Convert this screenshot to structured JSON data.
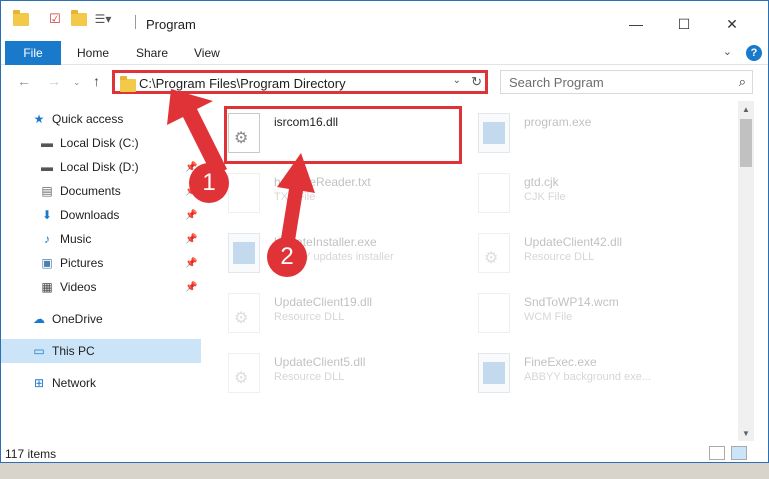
{
  "window": {
    "title": "Program",
    "controls": {
      "minimize": "—",
      "maximize": "☐",
      "close": "✕"
    }
  },
  "ribbon": {
    "tabs": [
      "File",
      "Home",
      "Share",
      "View"
    ],
    "help": "?"
  },
  "nav": {
    "address": "C:\\Program Files\\Program Directory",
    "search_placeholder": "Search Program"
  },
  "sidebar": {
    "items": [
      {
        "label": "Quick access",
        "icon": "star-icon",
        "pinned": false
      },
      {
        "label": "Local Disk (C:)",
        "icon": "drive-icon",
        "pinned": false
      },
      {
        "label": "Local Disk (D:)",
        "icon": "drive-icon",
        "pinned": true
      },
      {
        "label": "Documents",
        "icon": "documents-icon",
        "pinned": true
      },
      {
        "label": "Downloads",
        "icon": "download-icon",
        "pinned": true
      },
      {
        "label": "Music",
        "icon": "music-icon",
        "pinned": true
      },
      {
        "label": "Pictures",
        "icon": "pictures-icon",
        "pinned": true
      },
      {
        "label": "Videos",
        "icon": "videos-icon",
        "pinned": true
      },
      {
        "label": "OneDrive",
        "icon": "cloud-icon",
        "pinned": false
      },
      {
        "label": "This PC",
        "icon": "pc-icon",
        "pinned": false
      },
      {
        "label": "Network",
        "icon": "network-icon",
        "pinned": false
      }
    ]
  },
  "files": [
    {
      "name": "isrcom16.dll",
      "type": "",
      "icon": "gear"
    },
    {
      "name": "program.exe",
      "type": "",
      "icon": "app"
    },
    {
      "name": "helpFileReader.txt",
      "type": "TXT File",
      "icon": "blank"
    },
    {
      "name": "gtd.cjk",
      "type": "CJK File",
      "icon": "blank"
    },
    {
      "name": "UpdateInstaller.exe",
      "type": "ABBYY updates installer",
      "icon": "app"
    },
    {
      "name": "UpdateClient42.dll",
      "type": "Resource DLL",
      "icon": "gear"
    },
    {
      "name": "UpdateClient19.dll",
      "type": "Resource DLL",
      "icon": "gear"
    },
    {
      "name": "SndToWP14.wcm",
      "type": "WCM File",
      "icon": "blank"
    },
    {
      "name": "UpdateClient5.dll",
      "type": "Resource DLL",
      "icon": "gear"
    },
    {
      "name": "FineExec.exe",
      "type": "ABBYY background exe...",
      "icon": "app"
    }
  ],
  "status": {
    "items_count": "117 items"
  },
  "annotations": {
    "step1": "1",
    "step2": "2",
    "color": "#e03338"
  }
}
